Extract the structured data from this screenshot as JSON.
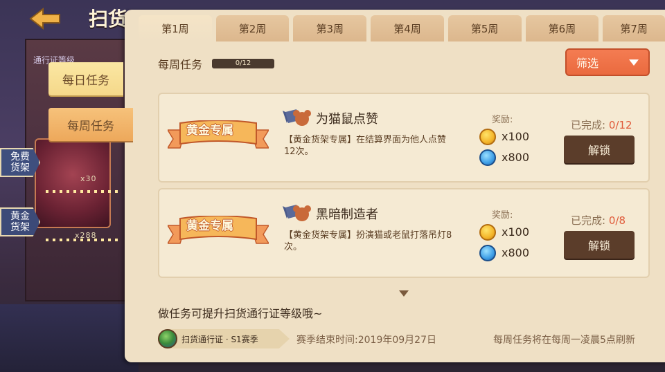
{
  "header": {
    "title": "扫货",
    "pass_level_label": "通行证等级"
  },
  "background": {
    "free_count": "x30",
    "gold_count": "x288"
  },
  "side_nav": {
    "daily": "每日任务",
    "weekly": "每周任务",
    "free_shelf": "免费货架",
    "gold_shelf": "黄金货架"
  },
  "week_tabs": [
    "第1周",
    "第2周",
    "第3周",
    "第4周",
    "第5周",
    "第6周",
    "第7周"
  ],
  "weekly_section": {
    "title": "每周任务",
    "progress_text": "0/12",
    "progress_fraction": 0,
    "filter_label": "筛选"
  },
  "tasks": [
    {
      "tag": "黄金专属",
      "title": "为猫鼠点赞",
      "description": "【黄金货架专属】在结算界面为他人点赞12次。",
      "reward_label": "奖励:",
      "rewards": [
        {
          "icon": "gold-coin-icon",
          "qty": "x100"
        },
        {
          "icon": "blue-token-icon",
          "qty": "x800"
        }
      ],
      "done_label": "已完成:",
      "done_value": "0/12",
      "action": "解锁"
    },
    {
      "tag": "黄金专属",
      "title": "黑暗制造者",
      "description": "【黄金货架专属】扮演猫或老鼠打落吊灯8次。",
      "reward_label": "奖励:",
      "rewards": [
        {
          "icon": "gold-coin-icon",
          "qty": "x100"
        },
        {
          "icon": "blue-token-icon",
          "qty": "x800"
        }
      ],
      "done_label": "已完成:",
      "done_value": "0/8",
      "action": "解锁"
    }
  ],
  "footer": {
    "hint": "做任务可提升扫货通行证等级哦~",
    "season_badge": "扫货通行证 · S1赛季",
    "season_end": "赛季结束时间:2019年09月27日",
    "refresh_note": "每周任务将在每周一凌晨5点刷新"
  },
  "colors": {
    "panel": "#efe0c5",
    "accent": "#ea6a3f",
    "unlock_btn": "#5b3d2a",
    "done_value": "#e05a3a"
  }
}
